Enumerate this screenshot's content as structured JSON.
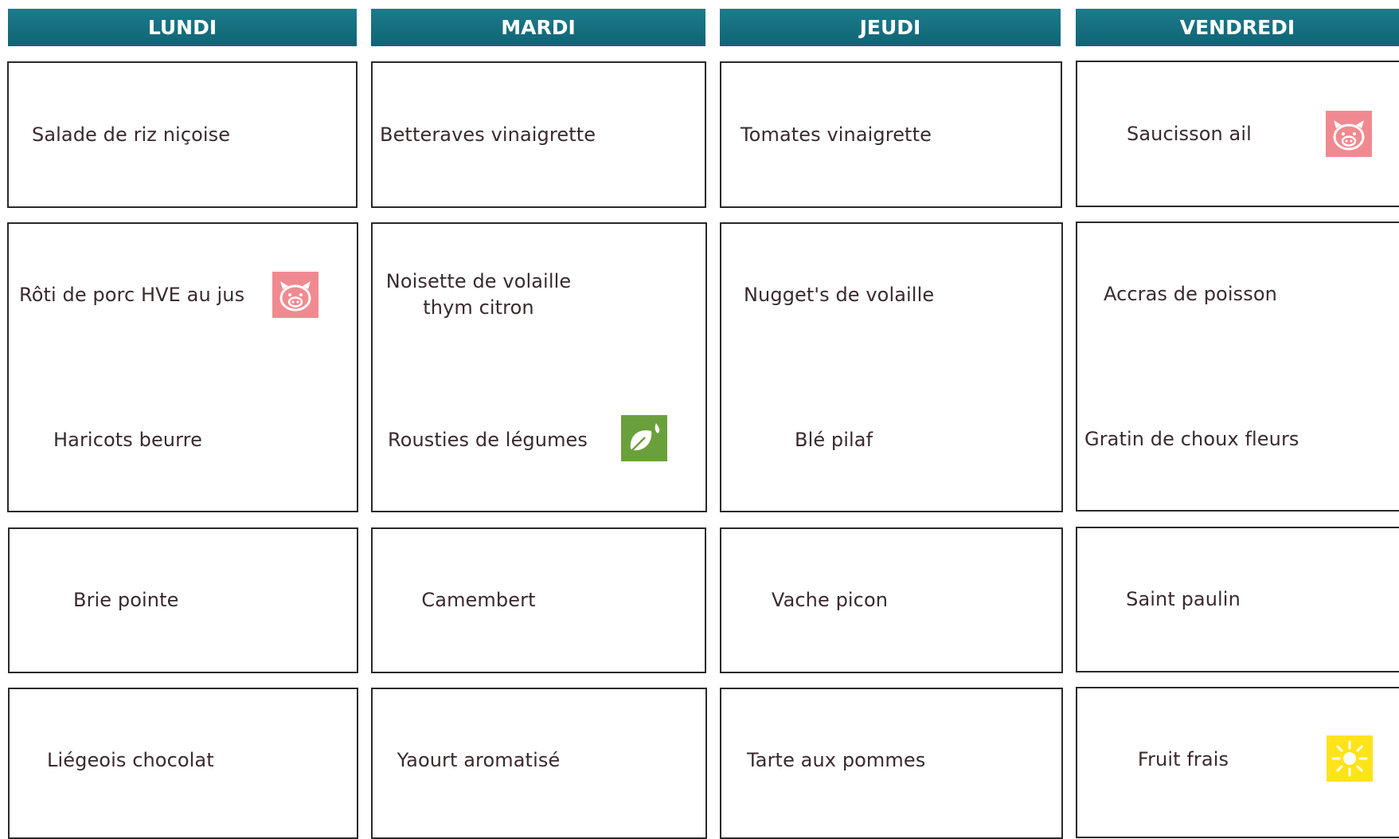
{
  "days": [
    "LUNDI",
    "MARDI",
    "JEUDI",
    "VENDREDI"
  ],
  "menu": {
    "lundi": {
      "entree": "Salade de riz niçoise",
      "plat": "Rôti de porc HVE au jus",
      "accompagnement": "Haricots beurre",
      "fromage": "Brie pointe",
      "dessert": "Liégeois chocolat"
    },
    "mardi": {
      "entree": "Betteraves vinaigrette",
      "plat_line1": "Noisette de volaille",
      "plat_line2": "thym citron",
      "accompagnement": "Rousties de légumes",
      "fromage": "Camembert",
      "dessert": "Yaourt aromatisé"
    },
    "jeudi": {
      "entree": "Tomates vinaigrette",
      "plat": "Nugget's de volaille",
      "accompagnement": "Blé pilaf",
      "fromage": "Vache picon",
      "dessert": "Tarte aux pommes"
    },
    "vendredi": {
      "entree": "Saucisson ail",
      "plat": "Accras de poisson",
      "accompagnement": "Gratin de choux fleurs",
      "fromage": "Saint paulin",
      "dessert": "Fruit frais"
    }
  },
  "icons": {
    "pork": "pig-icon",
    "vegetarian": "leaf-icon",
    "seasonal": "sun-icon"
  },
  "colors": {
    "header": "#137080",
    "pork": "#f08a90",
    "vegetarian": "#6aa03c",
    "seasonal": "#ffe31a"
  }
}
